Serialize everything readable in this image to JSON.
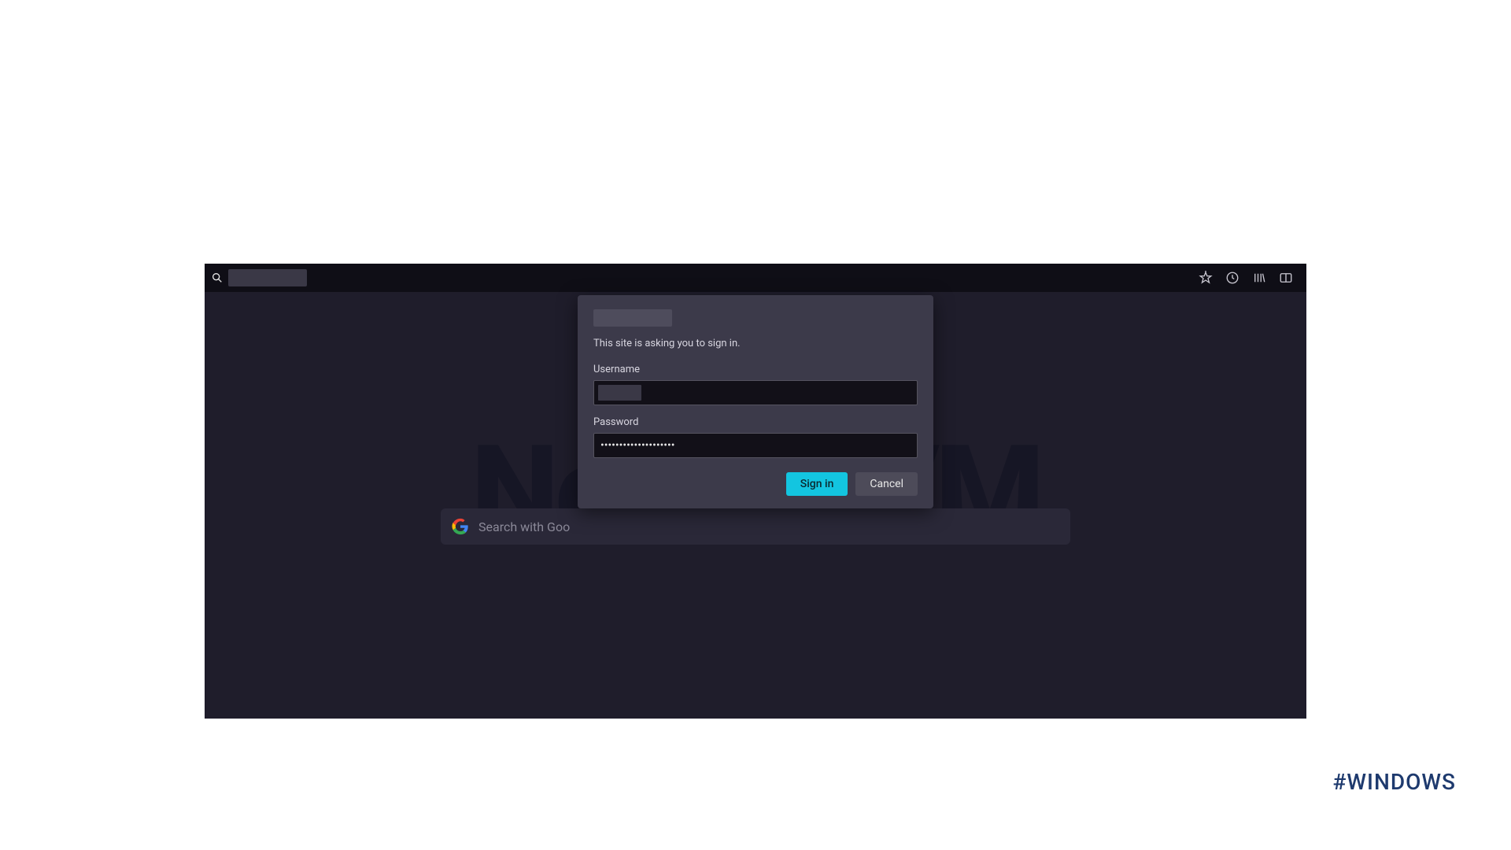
{
  "toolbar": {
    "url_redacted": true,
    "icons": [
      "star",
      "clock",
      "library",
      "reader"
    ]
  },
  "watermark": "NeuronVM",
  "search": {
    "placeholder": "Search with Goo"
  },
  "dialog": {
    "host_redacted": true,
    "message": "This site is asking you to sign in.",
    "username_label": "Username",
    "username_value": "",
    "password_label": "Password",
    "password_value": "••••••••••••••••••••",
    "sign_in_label": "Sign in",
    "cancel_label": "Cancel"
  },
  "footer": {
    "hashtag": "#WINDOWS"
  }
}
